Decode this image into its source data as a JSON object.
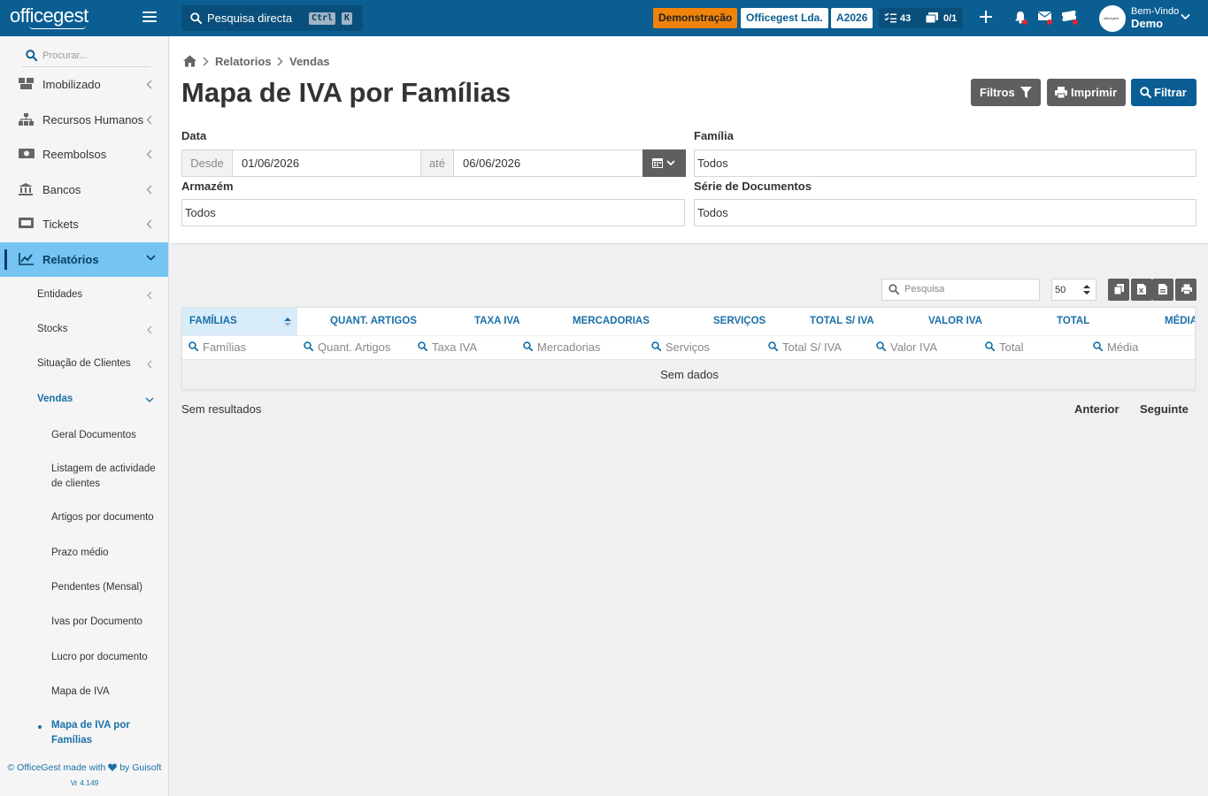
{
  "app": {
    "logo": "officegest",
    "search": {
      "placeholder": "Pesquisa directa",
      "kbd_ctrl": "Ctrl",
      "kbd_k": "K"
    },
    "badges": {
      "demo": "Demonstração",
      "company": "Officegest Lda.",
      "year": "A2026"
    },
    "counters": {
      "tasks": "43",
      "docs": "0/1"
    },
    "user": {
      "greeting": "Bem-Vindo",
      "name": "Demo",
      "avatar_text": "officegest"
    },
    "colors": {
      "primary": "#0b5e92",
      "demo_badge": "#f0830a",
      "active_menu": "#75c4f2",
      "link": "#1a70a8"
    }
  },
  "sidebar": {
    "search_placeholder": "Procurar...",
    "items": [
      {
        "label": "Imobilizado",
        "icon": "boxes-icon"
      },
      {
        "label": "Recursos Humanos",
        "icon": "sitemap-icon"
      },
      {
        "label": "Reembolsos",
        "icon": "money-icon"
      },
      {
        "label": "Bancos",
        "icon": "bank-icon"
      },
      {
        "label": "Tickets",
        "icon": "ticket-icon"
      },
      {
        "label": "Relatórios",
        "icon": "chart-line-icon"
      }
    ],
    "subitems": [
      {
        "label": "Entidades"
      },
      {
        "label": "Stocks"
      },
      {
        "label": "Situação de Clientes"
      },
      {
        "label": "Vendas"
      }
    ],
    "vendas": [
      {
        "label": "Geral Documentos"
      },
      {
        "label": "Listagem de actividade de clientes"
      },
      {
        "label": "Artigos por documento"
      },
      {
        "label": "Prazo médio"
      },
      {
        "label": "Pendentes (Mensal)"
      },
      {
        "label": "Ivas por Documento"
      },
      {
        "label": "Lucro por documento"
      },
      {
        "label": "Mapa de IVA"
      },
      {
        "label": "Mapa de IVA por Famílias"
      }
    ],
    "footer": {
      "credit_pre": "© OfficeGest made with",
      "credit_post": "by Guisoft",
      "version": "Vr 4.149"
    }
  },
  "breadcrumb": {
    "items": [
      "Relatorios",
      "Vendas"
    ]
  },
  "page": {
    "title": "Mapa de IVA por Famílias",
    "buttons": {
      "filters": "Filtros",
      "print": "Imprimir",
      "filter": "Filtrar"
    }
  },
  "form": {
    "date": {
      "label": "Data",
      "from_label": "Desde",
      "from": "01/06/2026",
      "to_label": "até",
      "to": "06/06/2026"
    },
    "family": {
      "label": "Família",
      "value": "Todos"
    },
    "warehouse": {
      "label": "Armazém",
      "value": "Todos"
    },
    "series": {
      "label": "Série de Documentos",
      "value": "Todos"
    }
  },
  "table": {
    "search_placeholder": "Pesquisa",
    "page_size": "50",
    "columns": [
      "FAMÍLIAS",
      "QUANT. ARTIGOS",
      "TAXA IVA",
      "MERCADORIAS",
      "SERVIÇOS",
      "TOTAL S/ IVA",
      "VALOR IVA",
      "TOTAL",
      "MÉDIA"
    ],
    "filters": [
      "Famílias",
      "Quant. Artigos",
      "Taxa IVA",
      "Mercadorias",
      "Serviços",
      "Total S/ IVA",
      "Valor IVA",
      "Total",
      "Média"
    ],
    "empty_text": "Sem dados"
  },
  "pagination": {
    "info": "Sem resultados",
    "prev": "Anterior",
    "next": "Seguinte"
  }
}
